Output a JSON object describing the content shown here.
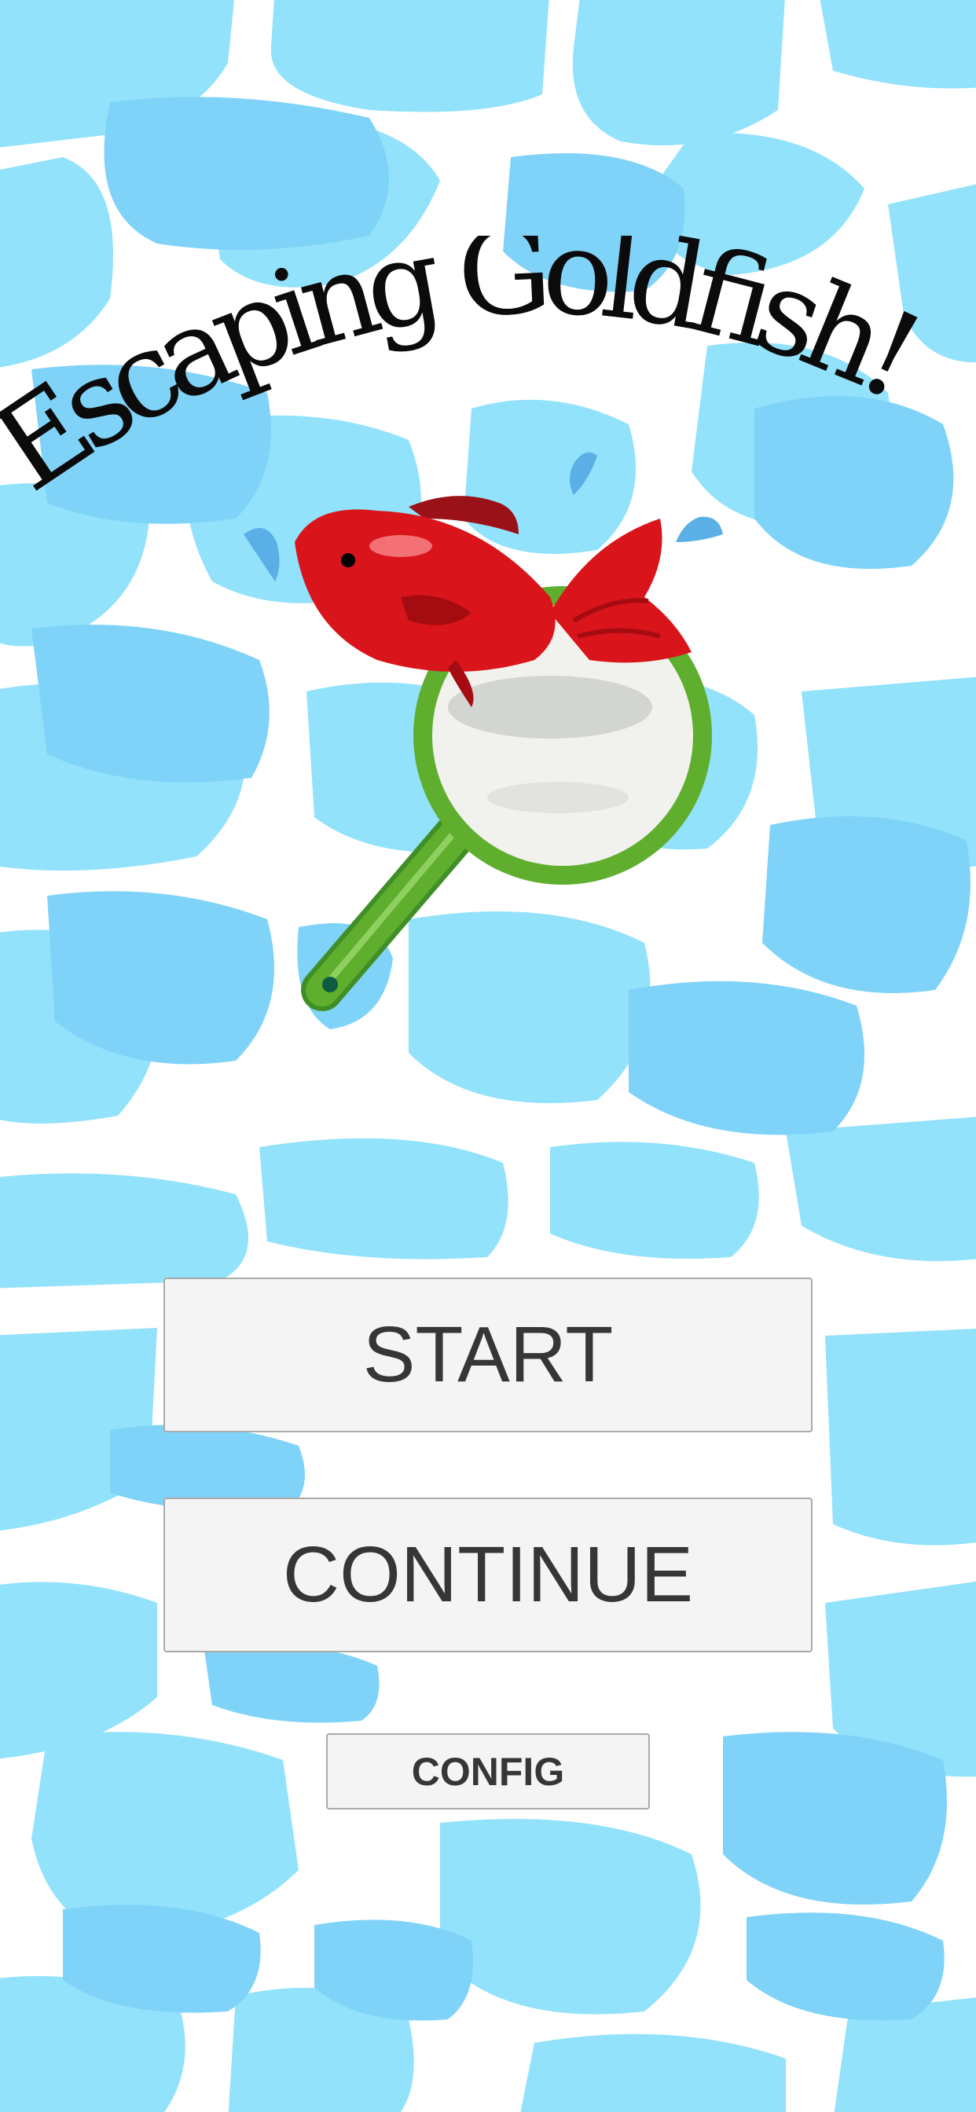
{
  "title": {
    "text": "Escaping Goldfish!"
  },
  "menu": {
    "start_label": "START",
    "continue_label": "CONTINUE",
    "config_label": "CONFIG"
  },
  "colors": {
    "water_light": "#92e2fb",
    "water_dark": "#7fd3f8",
    "grout": "#ffffff",
    "button_bg": "#f4f4f4",
    "button_text": "#363636",
    "fish_red": "#d9151b",
    "net_green": "#5fae2e"
  },
  "illustration": {
    "icon": "goldfish-jumping-from-scoop-net"
  }
}
